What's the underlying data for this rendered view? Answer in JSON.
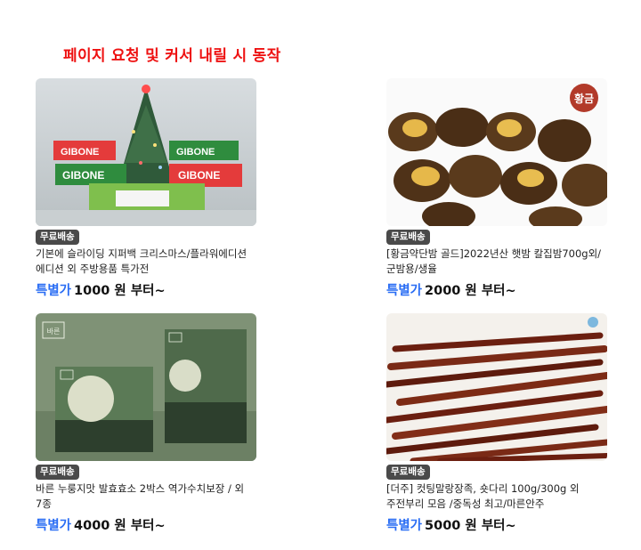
{
  "page_title": "페이지 요청 및 커서 내릴 시 동작",
  "products": [
    {
      "badge": "무료배송",
      "name": "기본에 슬라이딩 지퍼백 크리스마스/플라워에디션 에디션 외 주방용품 특가전",
      "price_label": "특별가",
      "price_value": "1000 원 부터~",
      "image": "christmas-zipper-bags-image",
      "image_text": "GIBONE"
    },
    {
      "badge": "무료배송",
      "name": "[황금약단밤 골드]2022년산 햇밤 칼집밤700g외/군밤용/생율",
      "price_label": "특별가",
      "price_value": "2000 원 부터~",
      "image": "roasted-chestnuts-image",
      "image_text": "황금"
    },
    {
      "badge": "무료배송",
      "name": "바른 누룽지맛 발효효소 2박스 역가수치보장 / 외 7종",
      "price_label": "특별가",
      "price_value": "4000 원 부터~",
      "image": "enzyme-box-image",
      "image_text": "바른"
    },
    {
      "badge": "무료배송",
      "name": "[더주] 컷팅말랑장족, 숏다리 100g/300g 외 주전부리 모음 /중독성 최고/마른안주",
      "price_label": "특별가",
      "price_value": "5000 원 부터~",
      "image": "dried-squid-legs-image",
      "image_text": ""
    }
  ],
  "colors": {
    "title": "#ee1111",
    "price_label": "#2a6df4",
    "badge_bg": "#4a4a4a"
  }
}
